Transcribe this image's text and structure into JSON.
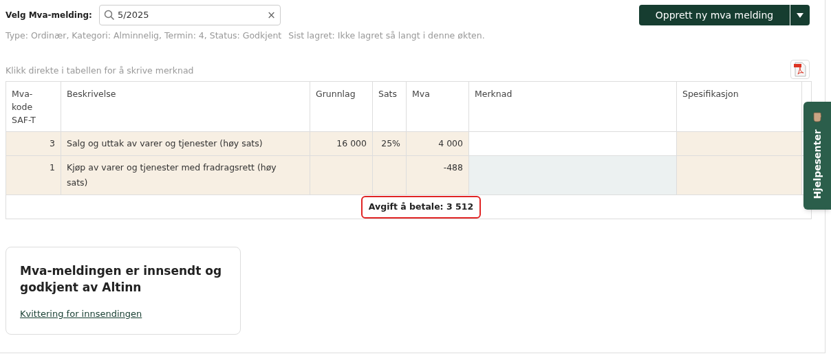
{
  "selector": {
    "label": "Velg Mva-melding:",
    "value": "5/2025",
    "clear": "×"
  },
  "info": "Type: Ordinær, Kategori: Alminnelig, Termin: 4, Status: Godkjent",
  "last_saved": "Sist lagret: Ikke lagret så langt i denne økten.",
  "create_button": {
    "label": "Opprett ny mva melding"
  },
  "hint": "Klikk direkte i tabellen for å skrive merknad",
  "table": {
    "columns": [
      "Mva-kode SAF-T",
      "Beskrivelse",
      "Grunnlag",
      "Sats",
      "Mva",
      "Merknad",
      "Spesifikasjon"
    ],
    "rows": [
      {
        "code": "3",
        "description": "Salg og uttak av varer og tjenester (høy sats)",
        "grunnlag": "16 000",
        "sats": "25%",
        "mva": "4 000",
        "merknad": {
          "color": "#ffffff"
        }
      },
      {
        "code": "1",
        "description": "Kjøp av varer og tjenester med fradragsrett (høy sats)",
        "mva": "-488",
        "merknad": {
          "color": "#ecf1f1"
        }
      }
    ],
    "total": "Avgift å betale: 3 512"
  },
  "status_card": {
    "title": "Mva-meldingen er innsendt og godkjent av Altinn",
    "link": "Kvittering for innsendingen"
  },
  "help_tab": "Hjelpesenter"
}
